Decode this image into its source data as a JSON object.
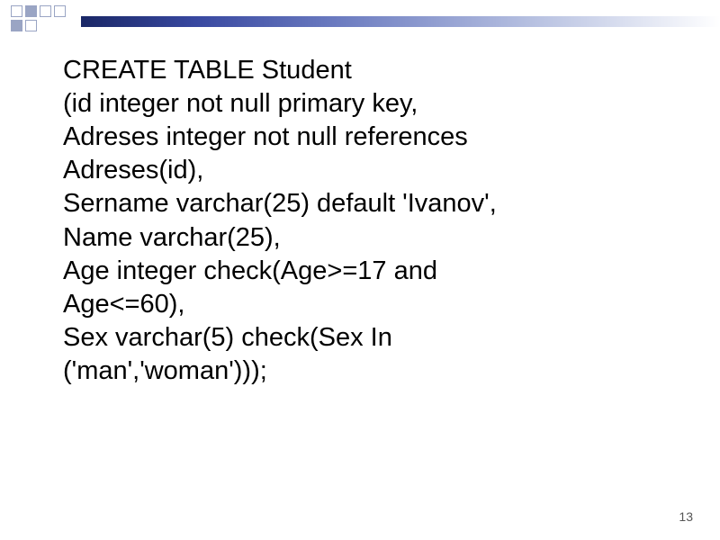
{
  "slide": {
    "lines": [
      "CREATE TABLE Student",
      "(id integer not null primary key,",
      "Adreses integer not null references",
      "Adreses(id),",
      "Sername varchar(25) default 'Ivanov',",
      "Name varchar(25),",
      "Age integer check(Age>=17 and",
      "Age<=60),",
      "Sex varchar(5) check(Sex In",
      "('man','woman')));"
    ],
    "page_number": "13"
  }
}
